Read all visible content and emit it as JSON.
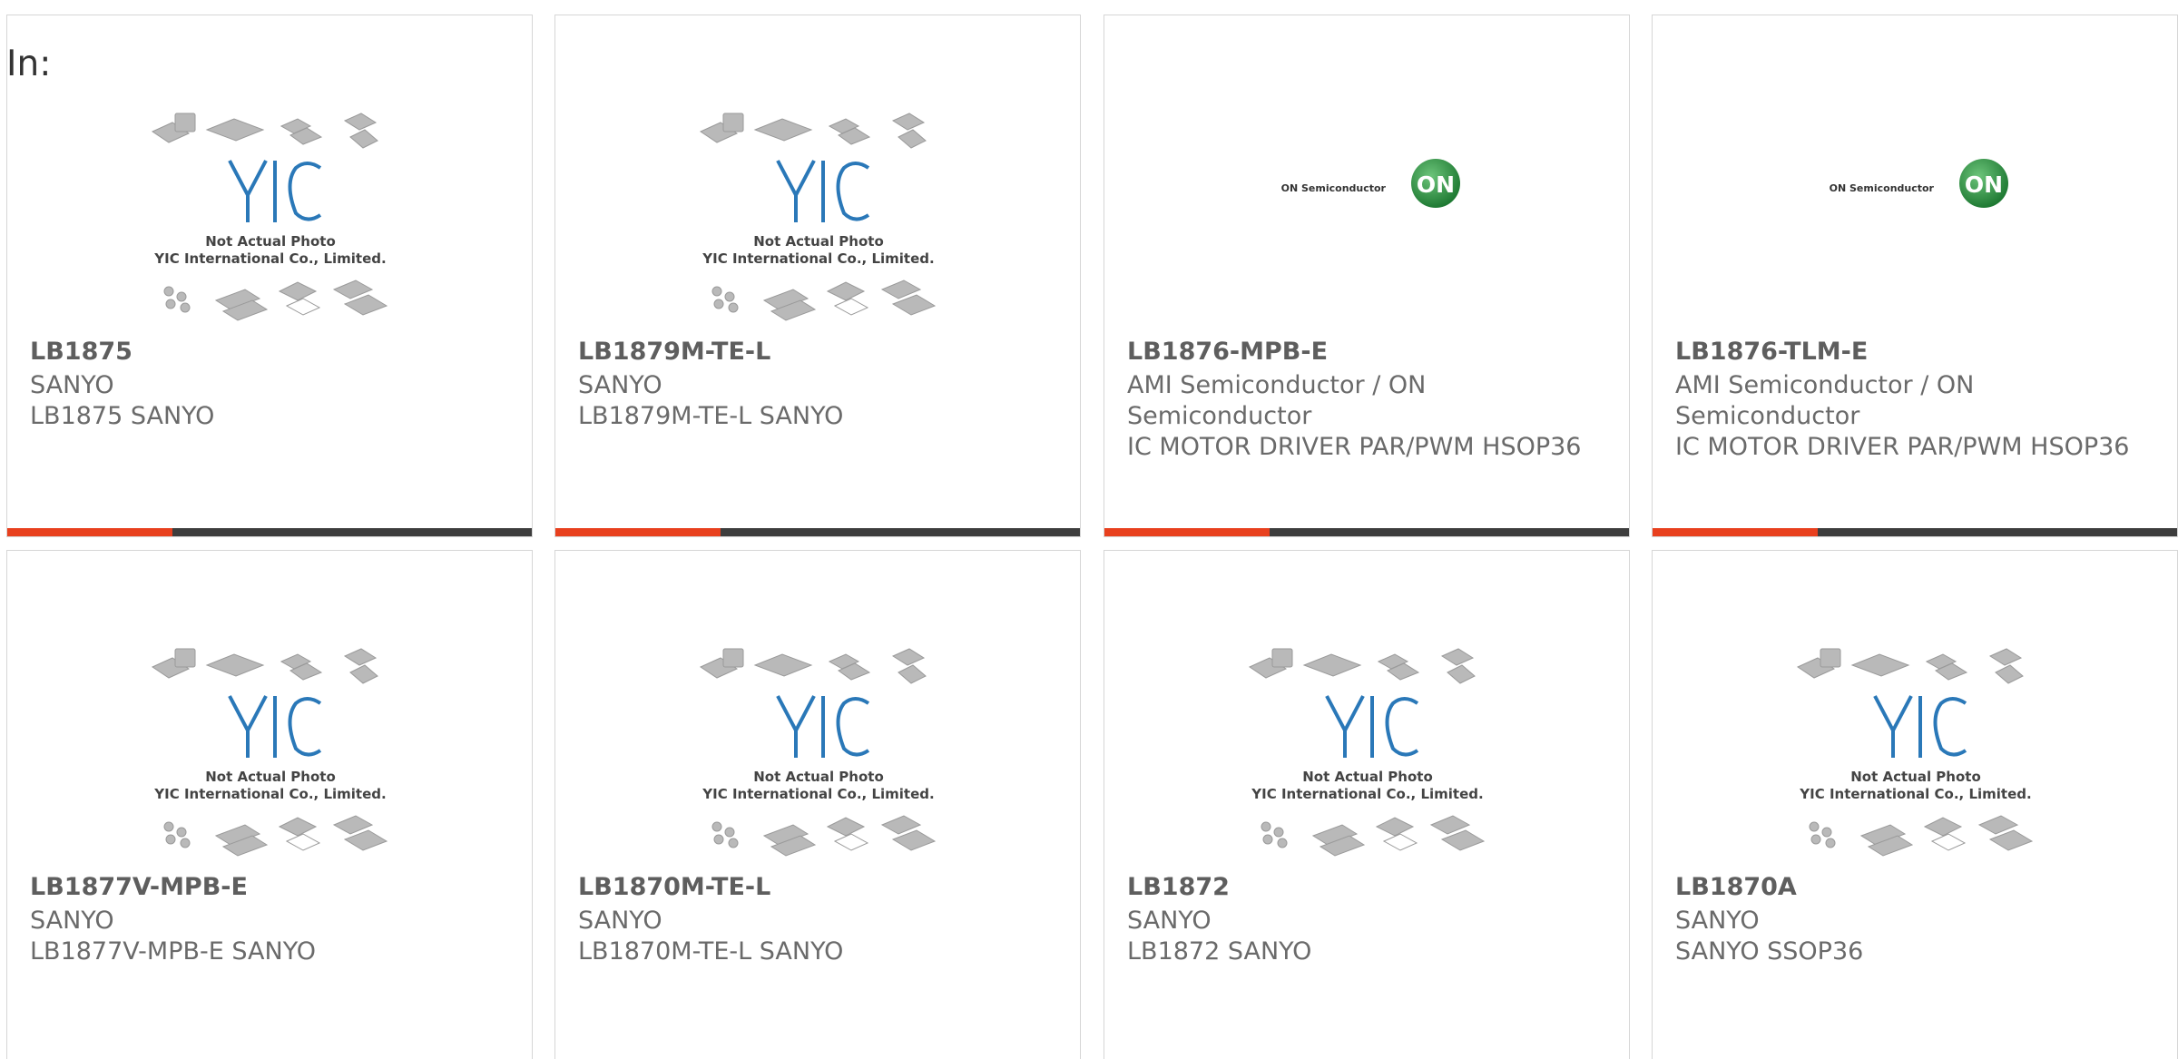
{
  "heading": "In:",
  "products": [
    {
      "part": "LB1875",
      "brand": "SANYO",
      "desc": "LB1875 SANYO",
      "image": "yic"
    },
    {
      "part": "LB1879M-TE-L",
      "brand": "SANYO",
      "desc": "LB1879M-TE-L SANYO",
      "image": "yic"
    },
    {
      "part": "LB1876-MPB-E",
      "brand": "AMI Semiconductor / ON Semiconductor",
      "desc": "IC MOTOR DRIVER PAR/PWM HSOP36",
      "image": "on"
    },
    {
      "part": "LB1876-TLM-E",
      "brand": "AMI Semiconductor / ON Semiconductor",
      "desc": "IC MOTOR DRIVER PAR/PWM HSOP36",
      "image": "on"
    },
    {
      "part": "LB1877V-MPB-E",
      "brand": "SANYO",
      "desc": "LB1877V-MPB-E SANYO",
      "image": "yic"
    },
    {
      "part": "LB1870M-TE-L",
      "brand": "SANYO",
      "desc": "LB1870M-TE-L SANYO",
      "image": "yic"
    },
    {
      "part": "LB1872",
      "brand": "SANYO",
      "desc": "LB1872 SANYO",
      "image": "yic"
    },
    {
      "part": "LB1870A",
      "brand": "SANYO",
      "desc": "SANYO SSOP36",
      "image": "yic"
    }
  ],
  "yic_image": {
    "line1": "Not Actual Photo",
    "line2": "YIC International Co., Limited."
  },
  "on_image": {
    "wordmark": "ON Semiconductor",
    "badge": "ON"
  },
  "colors": {
    "accent": "#e8401e",
    "bar": "#3d3d3d",
    "yic_blue": "#2a78b8",
    "on_green": "#1f8a3a"
  }
}
